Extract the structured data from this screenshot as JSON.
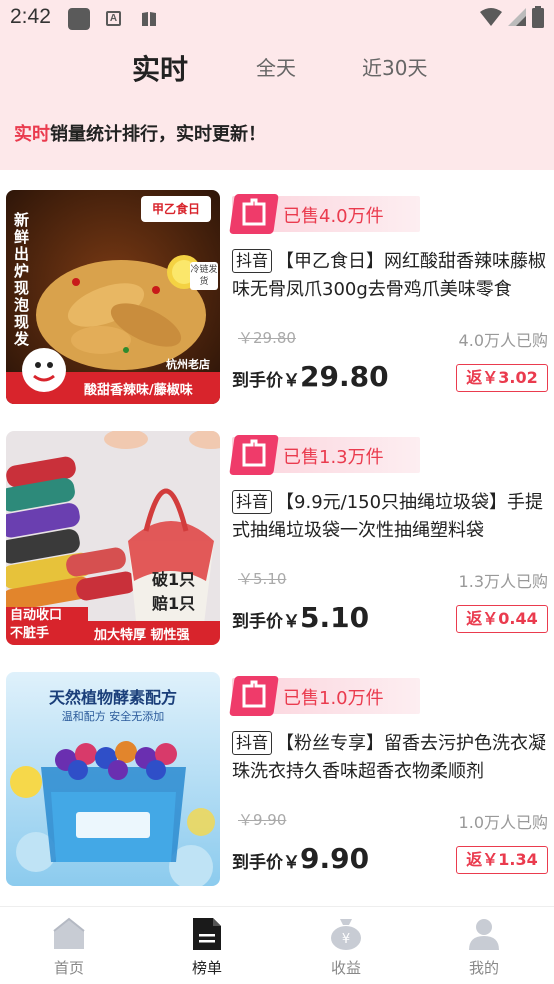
{
  "status_bar": {
    "time": "2:42",
    "icons": [
      "square-app-icon",
      "a-letter-icon",
      "book-icon",
      "wifi-icon",
      "signal-icon",
      "battery-icon"
    ]
  },
  "header": {
    "tabs": [
      {
        "label": "实时",
        "active": true
      },
      {
        "label": "全天",
        "active": false
      },
      {
        "label": "近30天",
        "active": false
      }
    ],
    "banner_highlight": "实时",
    "banner_text": "销量统计排行，实时更新！"
  },
  "products": [
    {
      "sold": "已售4.0万件",
      "platform": "抖音",
      "title": "【甲乙食日】网红酸甜香辣味藤椒味无骨凤爪300g去骨鸡爪美味零食",
      "original_price": "￥29.80",
      "buyers": "4.0万人已购",
      "final_label": "到手价￥",
      "final_price": "29.80",
      "rebate": "返￥3.02",
      "image": {
        "brand": "甲乙食日",
        "vertical_text": "新鲜出炉现泡现发",
        "badge": "冷链发货",
        "shop": "杭州老店",
        "flavor": "酸甜香辣味/藤椒味"
      }
    },
    {
      "sold": "已售1.3万件",
      "platform": "抖音",
      "title": "【9.9元/150只抽绳垃圾袋】手提式抽绳垃圾袋一次性抽绳塑料袋",
      "original_price": "￥5.10",
      "buyers": "1.3万人已购",
      "final_label": "到手价￥",
      "final_price": "5.10",
      "rebate": "返￥0.44",
      "image": {
        "promise_1": "破1只",
        "promise_2": "赔1只",
        "left_text_1": "自动收口",
        "left_text_2": "不脏手",
        "right_text": "加大特厚 韧性强"
      }
    },
    {
      "sold": "已售1.0万件",
      "platform": "抖音",
      "title": "【粉丝专享】留香去污护色洗衣凝珠洗衣持久香味超香衣物柔顺剂",
      "original_price": "￥9.90",
      "buyers": "1.0万人已购",
      "final_label": "到手价￥",
      "final_price": "9.90",
      "rebate": "返￥1.34",
      "image": {
        "headline": "天然植物酵素配方",
        "subline": "温和配方 安全无添加"
      }
    }
  ],
  "tab_bar": [
    {
      "label": "首页",
      "icon": "home-icon",
      "active": false
    },
    {
      "label": "榜单",
      "icon": "ranking-document-icon",
      "active": true
    },
    {
      "label": "收益",
      "icon": "money-bag-icon",
      "active": false
    },
    {
      "label": "我的",
      "icon": "user-icon",
      "active": false
    }
  ],
  "colors": {
    "accent": "#ea3b4e",
    "header_bg": "#fde8ea",
    "sold_tag": "#ef3b6a"
  }
}
